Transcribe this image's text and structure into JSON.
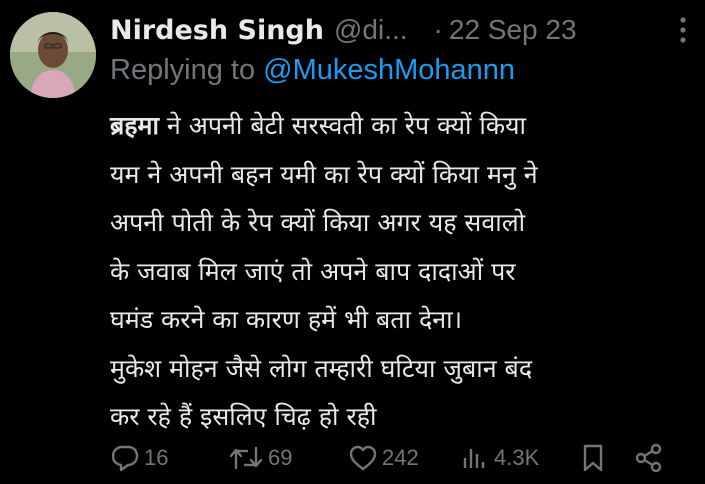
{
  "author": {
    "name": "Nirdesh Singh",
    "handle": "@di...",
    "separator": "·",
    "date": "22 Sep 23",
    "avatar_icon": "profile-avatar"
  },
  "reply": {
    "prefix": "Replying to ",
    "mention": "@MukeshMohannn"
  },
  "tweet": {
    "bold_word": "ब्रहमा",
    "lines": [
      " ने अपनी बेटी सरस्वती का रेप क्यों किया",
      "यम ने अपनी बहन यमी का रेप क्यों किया मनु ने",
      "अपनी पोती के रेप क्यों किया अगर यह सवालो",
      "के जवाब मिल जाएं तो अपने बाप दादाओं पर",
      "घमंड करने का कारण हमें भी बता देना।",
      "मुकेश मोहन जैसे लोग तम्हारी घटिया जुबान बंद",
      "कर रहे हैं इसलिए चिढ़ हो रही"
    ]
  },
  "actions": {
    "replies": "16",
    "reposts": "69",
    "likes": "242",
    "views": "4.3K"
  },
  "colors": {
    "background": "#000000",
    "text": "#e7e9ea",
    "muted": "#71767b",
    "link": "#1d9bf0"
  }
}
